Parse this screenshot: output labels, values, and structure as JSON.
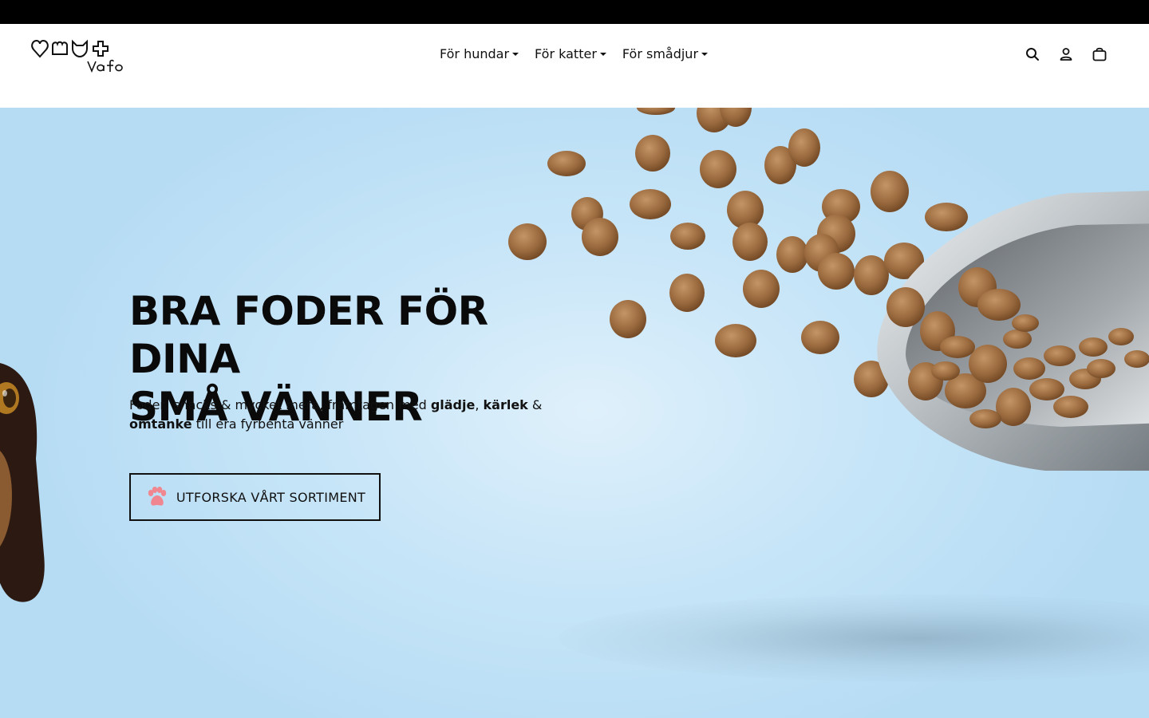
{
  "brand": {
    "name": "Vafo"
  },
  "nav": {
    "items": [
      {
        "label": "För hundar"
      },
      {
        "label": "För katter"
      },
      {
        "label": "För smådjur"
      }
    ]
  },
  "header_icons": [
    "search-icon",
    "account-icon",
    "cart-icon"
  ],
  "hero": {
    "title_line1": "BRA FODER FÖR DINA",
    "title_line2": "SMÅ VÄNNER",
    "text_part1": "Foder, snacks & mycket mera, framtagen med ",
    "bold1": "glädje",
    "sep1": ", ",
    "bold2": "kärlek",
    "sep2": " & ",
    "bold3": "omtanke",
    "text_part2": " till era fyrbenta vänner",
    "cta_label": "UTFORSKA VÅRT SORTIMENT"
  },
  "colors": {
    "topbar": "#000000",
    "hero_bg": "#c9e6f8",
    "text": "#111111",
    "paw_accent": "#f0868f",
    "kibble": "#9a6a3e"
  }
}
